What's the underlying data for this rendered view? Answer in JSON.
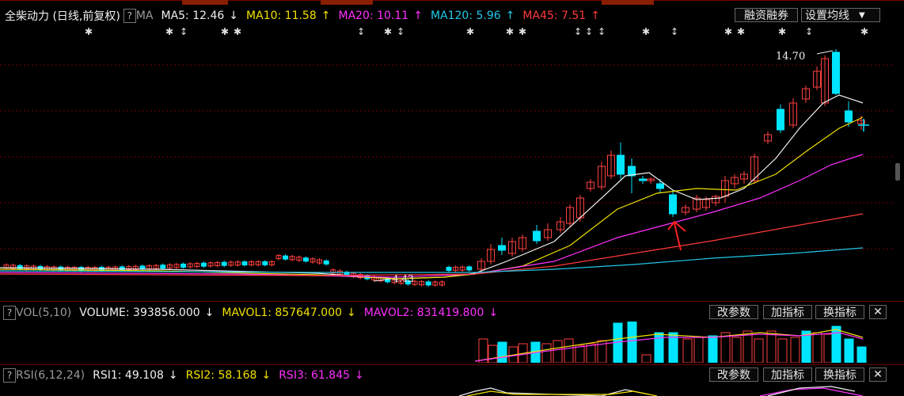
{
  "main": {
    "title": "全柴动力 (日线,前复权)",
    "help_label": "?",
    "ma_label": "MA",
    "indicators": [
      {
        "text": "MA5: 12.46",
        "arrow": "↓",
        "color": "#f0f0f0"
      },
      {
        "text": "MA10: 11.58",
        "arrow": "↑",
        "color": "#f0e000"
      },
      {
        "text": "MA20: 10.11",
        "arrow": "↑",
        "color": "#ff30ff"
      },
      {
        "text": "MA120: 5.96",
        "arrow": "↑",
        "color": "#20c8e8"
      },
      {
        "text": "MA45: 7.51",
        "arrow": "↑",
        "color": "#ff3a3a"
      }
    ],
    "buttons": {
      "margin": "融资融券",
      "ma_settings": "设置均线"
    },
    "high_label": "14.70",
    "low_label": "4.43"
  },
  "volume": {
    "help_label": "?",
    "name": "VOL(5,10)",
    "indicators": [
      {
        "text": "VOLUME: 393856.000",
        "arrow": "↓",
        "color": "#f0f0f0"
      },
      {
        "text": "MAVOL1: 857647.000",
        "arrow": "↓",
        "color": "#f0e000"
      },
      {
        "text": "MAVOL2: 831419.800",
        "arrow": "↓",
        "color": "#ff30ff"
      }
    ],
    "buttons": {
      "params": "改参数",
      "add": "加指标",
      "switch": "换指标",
      "close": "✕"
    }
  },
  "rsi": {
    "help_label": "?",
    "name": "RSI(6,12,24)",
    "indicators": [
      {
        "text": "RSI1: 49.108",
        "arrow": "↓",
        "color": "#f0f0f0"
      },
      {
        "text": "RSI2: 58.168",
        "arrow": "↓",
        "color": "#f0e000"
      },
      {
        "text": "RSI3: 61.845",
        "arrow": "↓",
        "color": "#ff30ff"
      }
    ],
    "buttons": {
      "params": "改参数",
      "add": "加指标",
      "switch": "换指标",
      "close": "✕"
    }
  },
  "colors": {
    "up": "#ff4040",
    "down": "#00e5ff",
    "grid": "#7a0000"
  }
}
